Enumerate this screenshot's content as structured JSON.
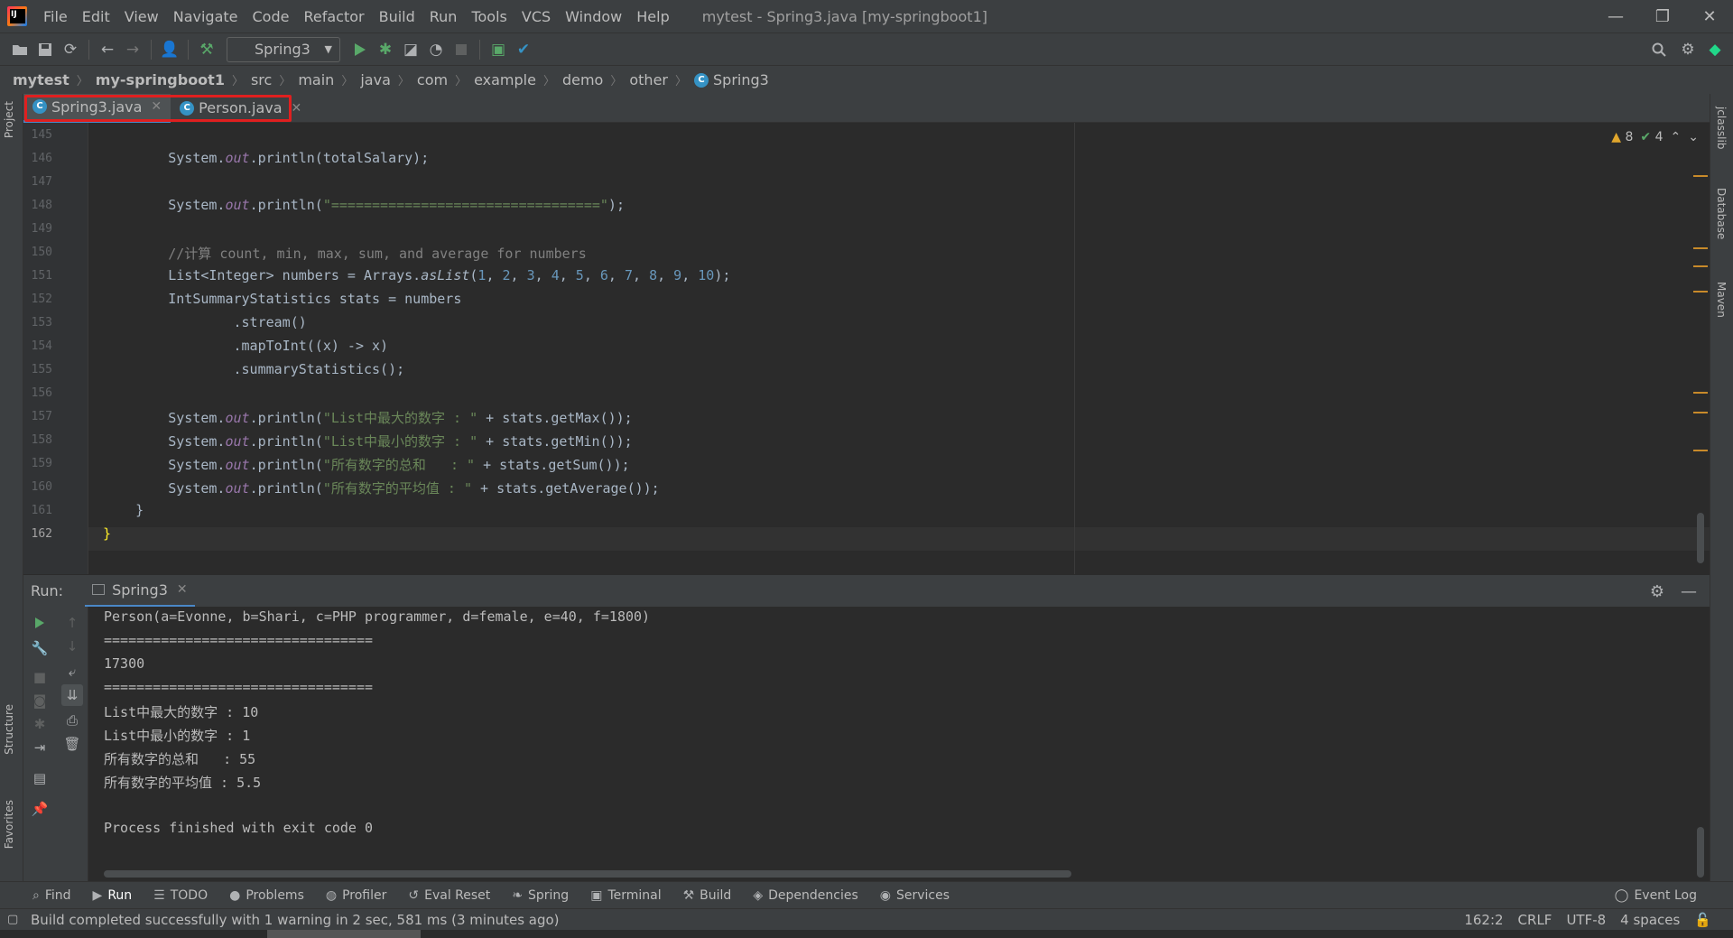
{
  "window": {
    "title": "mytest - Spring3.java [my-springboot1]",
    "menu": [
      "File",
      "Edit",
      "View",
      "Navigate",
      "Code",
      "Refactor",
      "Build",
      "Run",
      "Tools",
      "VCS",
      "Window",
      "Help"
    ],
    "controls": {
      "minimize": "—",
      "restore": "❐",
      "close": "✕"
    }
  },
  "toolbar": {
    "run_config": "Spring3",
    "icons": [
      "open-icon",
      "save-icon",
      "sync-icon",
      "back-icon",
      "forward-icon",
      "vcs-icon",
      "build-hammer-icon",
      "run-icon",
      "debug-icon",
      "coverage-icon",
      "profile-icon",
      "stop-icon",
      "jrebel-icon",
      "commit-icon",
      "search-icon",
      "settings-icon",
      "toolbox-icon"
    ]
  },
  "breadcrumb": [
    "mytest",
    "my-springboot1",
    "src",
    "main",
    "java",
    "com",
    "example",
    "demo",
    "other",
    "Spring3"
  ],
  "tabs": [
    {
      "label": "Spring3.java",
      "active": true
    },
    {
      "label": "Person.java",
      "active": false
    }
  ],
  "left_strip": {
    "project": "Project",
    "structure": "Structure",
    "favorites": "Favorites"
  },
  "right_strip": {
    "jclasslib": "jclasslib",
    "database": "Database",
    "maven": "Maven"
  },
  "inspections": {
    "warnings": "8",
    "ok": "4"
  },
  "editor": {
    "line_numbers": [
      "145",
      "146",
      "147",
      "148",
      "149",
      "150",
      "151",
      "152",
      "153",
      "154",
      "155",
      "156",
      "157",
      "158",
      "159",
      "160",
      "161",
      "162"
    ],
    "current_line": "162",
    "code": {
      "l146": {
        "a": "        System.",
        "field": "out",
        "b": ".println(totalSalary);"
      },
      "l148": {
        "a": "        System.",
        "field": "out",
        "b": ".println(",
        "str": "\"=================================\"",
        "c": ");"
      },
      "l150": {
        "comment": "        //计算 count, min, max, sum, and average for numbers"
      },
      "l151": {
        "a": "        List<Integer> numbers = Arrays.",
        "method": "asList",
        "b": "(",
        "nums": [
          "1",
          "2",
          "3",
          "4",
          "5",
          "6",
          "7",
          "8",
          "9",
          "10"
        ],
        "c": ");"
      },
      "l152": {
        "a": "        IntSummaryStatistics stats = numbers"
      },
      "l153": {
        "a": "                .stream()"
      },
      "l154": {
        "a": "                .mapToInt((x) -> x)"
      },
      "l155": {
        "a": "                .summaryStatistics();"
      },
      "l157": {
        "a": "        System.",
        "field": "out",
        "b": ".println(",
        "str": "\"List中最大的数字 : \"",
        "c": " + stats.getMax());"
      },
      "l158": {
        "a": "        System.",
        "field": "out",
        "b": ".println(",
        "str": "\"List中最小的数字 : \"",
        "c": " + stats.getMin());"
      },
      "l159": {
        "a": "        System.",
        "field": "out",
        "b": ".println(",
        "str": "\"所有数字的总和   : \"",
        "c": " + stats.getSum());"
      },
      "l160": {
        "a": "        System.",
        "field": "out",
        "b": ".println(",
        "str": "\"所有数字的平均值 : \"",
        "c": " + stats.getAverage());"
      },
      "l161": {
        "a": "    }"
      },
      "l162": {
        "brace": "}"
      }
    }
  },
  "run_panel": {
    "label": "Run:",
    "tab": "Spring3",
    "console": [
      "Person(a=Evonne, b=Shari, c=PHP programmer, d=female, e=40, f=1800)",
      "=================================",
      "17300",
      "=================================",
      "List中最大的数字 : 10",
      "List中最小的数字 : 1",
      "所有数字的总和   : 55",
      "所有数字的平均值 : 5.5",
      "",
      "Process finished with exit code 0"
    ]
  },
  "tool_windows": [
    {
      "label": "Find",
      "icon": "search-icon"
    },
    {
      "label": "Run",
      "icon": "run-icon"
    },
    {
      "label": "TODO",
      "icon": "list-icon"
    },
    {
      "label": "Problems",
      "icon": "info-icon"
    },
    {
      "label": "Profiler",
      "icon": "profiler-icon"
    },
    {
      "label": "Eval Reset",
      "icon": "reset-icon"
    },
    {
      "label": "Spring",
      "icon": "spring-icon"
    },
    {
      "label": "Terminal",
      "icon": "terminal-icon"
    },
    {
      "label": "Build",
      "icon": "hammer-icon"
    },
    {
      "label": "Dependencies",
      "icon": "dependencies-icon"
    },
    {
      "label": "Services",
      "icon": "services-icon"
    }
  ],
  "event_log": "Event Log",
  "status": {
    "message": "Build completed successfully with 1 warning in 2 sec, 581 ms (3 minutes ago)",
    "position": "162:2",
    "line_sep": "CRLF",
    "encoding": "UTF-8",
    "indent": "4 spaces"
  },
  "colors": {
    "accent": "#4a88c7",
    "highlight_box": "#e01f1f",
    "warning": "#e0a62c",
    "run_green": "#59a869"
  }
}
